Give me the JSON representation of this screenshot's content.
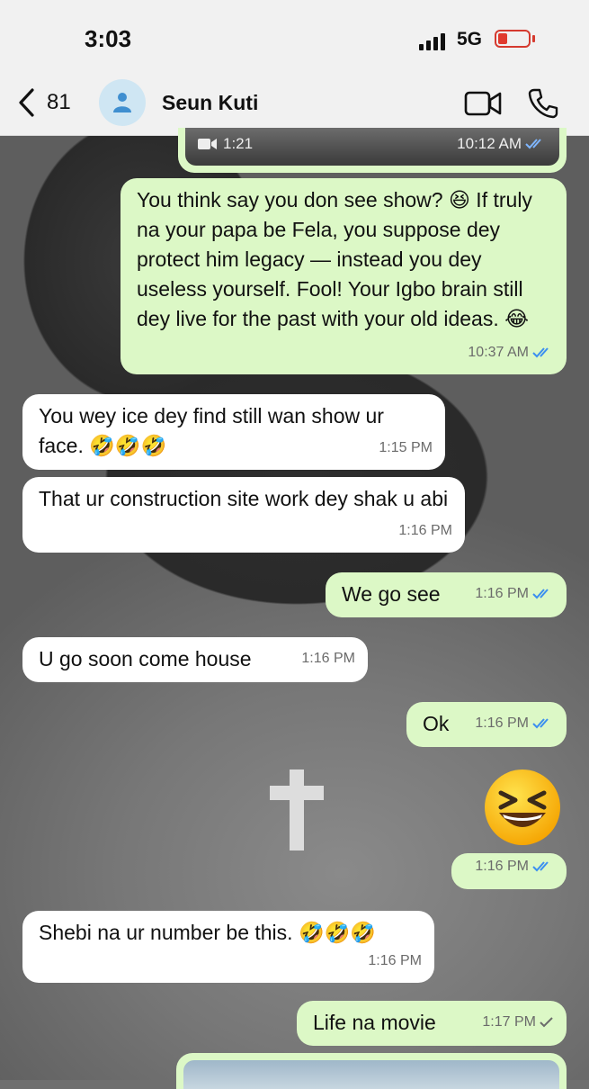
{
  "status": {
    "time": "3:03",
    "network": "5G"
  },
  "header": {
    "back_count": "81",
    "contact_name": "Seun Kuti"
  },
  "top_media": {
    "duration": "1:21",
    "time": "10:12 AM"
  },
  "messages": [
    {
      "text": "You think say you don see show? 😆 If truly na your papa be Fela, you suppose dey protect him legacy — instead you dey useless yourself. Fool! Your Igbo brain still dey live for the past with your old ideas. 😂",
      "time": "10:37 AM"
    },
    {
      "text": "You wey ice dey find still wan show ur face. 🤣🤣🤣",
      "time": "1:15 PM"
    },
    {
      "text": "That ur construction site work dey shak u abi",
      "time": "1:16 PM"
    },
    {
      "text": "We go see",
      "time": "1:16 PM"
    },
    {
      "text": "U go soon come house",
      "time": "1:16 PM"
    },
    {
      "text": "Ok",
      "time": "1:16 PM"
    },
    {
      "text": "",
      "time": "1:16 PM"
    },
    {
      "text": "Shebi na ur number be this. 🤣🤣🤣",
      "time": "1:16 PM"
    },
    {
      "text": "Life na movie",
      "time": "1:17 PM"
    }
  ],
  "colors": {
    "outgoing": "#dcf8c6",
    "incoming": "#ffffff",
    "read_ticks": "#3b8ff0"
  }
}
